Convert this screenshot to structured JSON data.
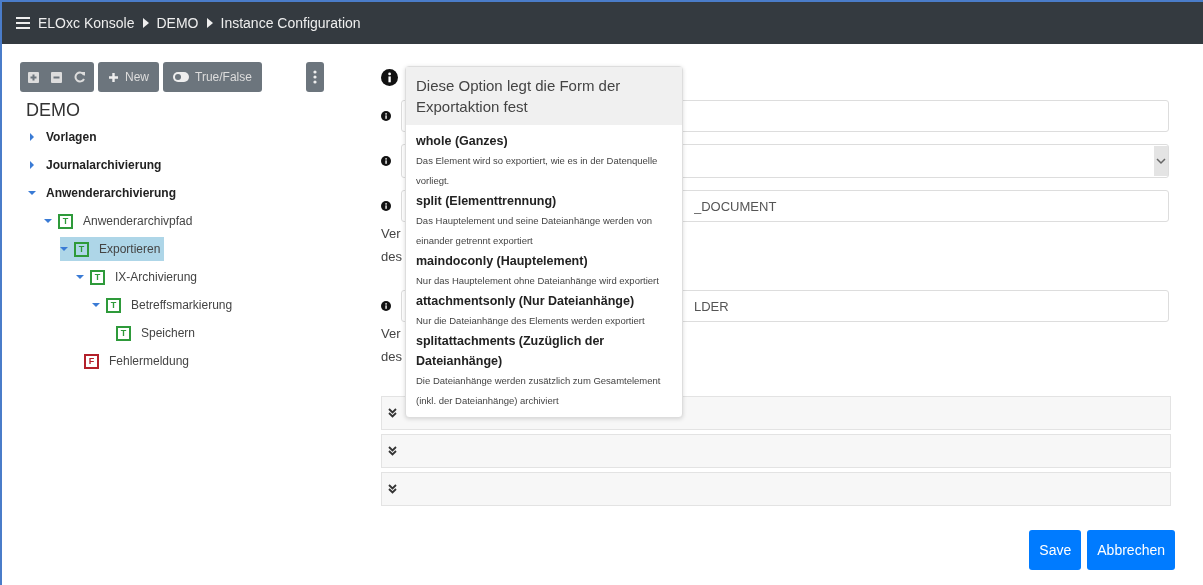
{
  "topbar": {
    "breadcrumb": [
      "ELOxc Konsole",
      "DEMO",
      "Instance Configuration"
    ]
  },
  "toolbar": [
    {
      "kind": "expand-all"
    },
    {
      "kind": "collapse-all"
    },
    {
      "kind": "refresh"
    },
    {
      "kind": "new",
      "label": "New"
    },
    {
      "kind": "toggle",
      "label": "True/False"
    }
  ],
  "tree": {
    "root": "DEMO",
    "children": [
      {
        "label": "Vorlagen",
        "expanded": false,
        "selected": false
      },
      {
        "label": "Journalarchivierung",
        "expanded": false,
        "selected": false
      },
      {
        "label": "Anwenderarchivierung",
        "expanded": true,
        "selected": false,
        "children": [
          {
            "label": "Anwenderarchivpfad",
            "badge": "T",
            "color": "#2e9a3a",
            "expanded": true,
            "selected": false,
            "children": [
              {
                "label": "Exportieren",
                "badge": "T",
                "color": "#2e9a3a",
                "expanded": true,
                "selected": true,
                "children": [
                  {
                    "label": "IX-Archivierung",
                    "badge": "T",
                    "color": "#2e9a3a",
                    "expanded": true,
                    "selected": false,
                    "children": [
                      {
                        "label": "Betreffsmarkierung",
                        "badge": "T",
                        "color": "#2e9a3a",
                        "expanded": true,
                        "selected": false,
                        "children": [
                          {
                            "label": "Speichern",
                            "badge": "T",
                            "color": "#2e9a3a",
                            "selected": false
                          }
                        ]
                      }
                    ]
                  },
                  {
                    "label": "Fehlermeldung",
                    "badge": "F",
                    "color": "#b3202a",
                    "selected": false
                  }
                ]
              }
            ]
          }
        ]
      }
    ]
  },
  "form": {
    "rows": [
      {
        "kind": "input"
      },
      {
        "kind": "select"
      },
      {
        "kind": "input",
        "value": "_DOCUMENT",
        "help": [
          "Ver",
          "des"
        ]
      },
      {
        "kind": "input",
        "value": "LDER",
        "help": [
          "Ver",
          "des"
        ]
      }
    ],
    "sections": [
      {
        "expanded": false
      },
      {
        "expanded": false
      },
      {
        "expanded": false
      }
    ]
  },
  "popover": {
    "title": "Diese Option legt die Form der Exportaktion fest",
    "options": [
      {
        "name": "whole (Ganzes)",
        "description": "Das Element wird so exportiert, wie es in der Datenquelle vorliegt."
      },
      {
        "name": "split (Elementtrennung)",
        "description": "Das Hauptelement und seine Dateianhänge werden von einander getrennt exportiert"
      },
      {
        "name": "maindoconly (Hauptelement)",
        "description": "Nur das Hauptelement ohne Dateianhänge wird exportiert"
      },
      {
        "name": "attachmentsonly (Nur Dateianhänge)",
        "description": "Nur die Dateianhänge des Elements werden exportiert"
      },
      {
        "name": "splitattachments (Zuzüglich der Dateianhänge)",
        "description": "Die Dateianhänge werden zusätzlich zum Gesamtelement (inkl. der Dateianhänge) archiviert"
      }
    ]
  },
  "buttons": [
    "Save",
    "Abbrechen"
  ]
}
